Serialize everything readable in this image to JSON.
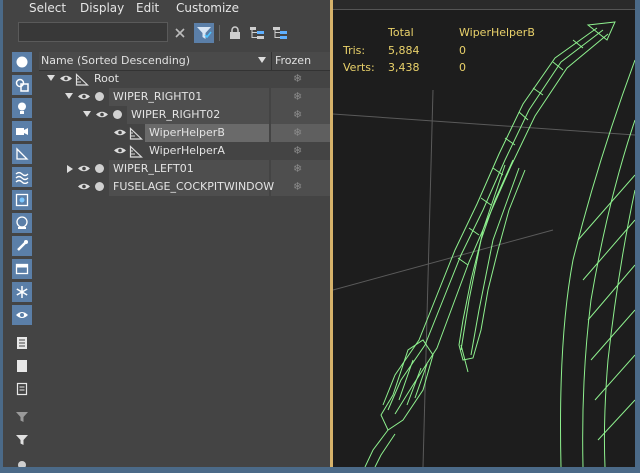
{
  "menu": {
    "items": [
      "Select",
      "Display",
      "Edit",
      "Customize"
    ]
  },
  "explorer": {
    "search": {
      "value": "",
      "placeholder": ""
    },
    "header": {
      "name_col": "Name (Sorted Descending)",
      "frozen_col": "Frozen"
    },
    "rows": [
      {
        "label": "Root",
        "expand": "down",
        "icon": "helper-icon"
      },
      {
        "label": "WIPER_RIGHT01",
        "expand": "down",
        "icon": "dot"
      },
      {
        "label": "WIPER_RIGHT02",
        "expand": "down",
        "icon": "dot"
      },
      {
        "label": "WiperHelperB",
        "expand": "none",
        "icon": "helper-icon",
        "selected": true
      },
      {
        "label": "WiperHelperA",
        "expand": "none",
        "icon": "helper-icon"
      },
      {
        "label": "WIPER_LEFT01",
        "expand": "right",
        "icon": "dot"
      },
      {
        "label": "FUSELAGE_COCKPITWINDOW",
        "expand": "none",
        "icon": "dot"
      }
    ],
    "frozen_glyph": "❄"
  },
  "viewport": {
    "stats": {
      "col_total": "Total",
      "col_selected": "WiperHelperB",
      "tris_label": "Tris:",
      "tris_total": "5,884",
      "tris_selected": "0",
      "verts_label": "Verts:",
      "verts_total": "3,438",
      "verts_selected": "0"
    },
    "stat_color": "#e9d16a",
    "wire_color": "#8ef08e"
  },
  "colors": {
    "accent": "#5b7fa8",
    "panel": "#444444",
    "divider": "#d6b26a"
  }
}
